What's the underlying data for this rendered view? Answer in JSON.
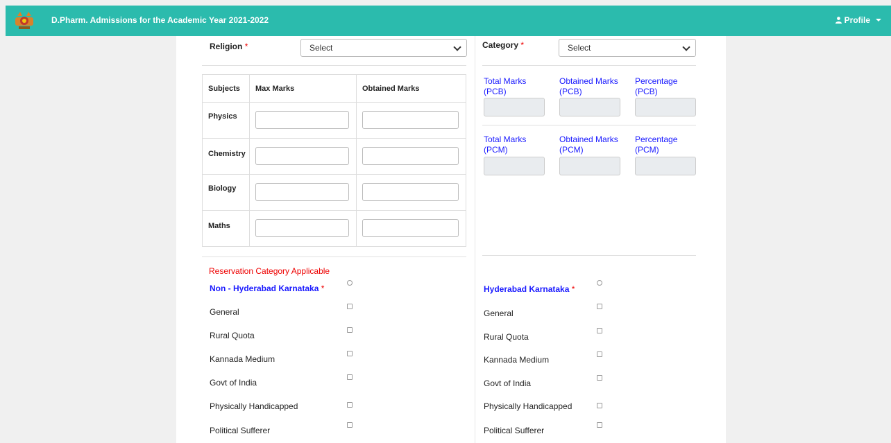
{
  "header": {
    "title": "D.Pharm. Admissions for the Academic Year 2021-2022",
    "profile_label": "Profile",
    "colors": {
      "bar": "#2bbbad"
    }
  },
  "form": {
    "religion": {
      "label": "Religion",
      "required_mark": "*",
      "value": "Select"
    },
    "category": {
      "label": "Category",
      "required_mark": "*",
      "value": "Select"
    },
    "marks_table": {
      "headers": [
        "Subjects",
        "Max Marks",
        "Obtained Marks"
      ],
      "rows": [
        {
          "subject": "Physics",
          "max": "",
          "obtained": ""
        },
        {
          "subject": "Chemistry",
          "max": "",
          "obtained": ""
        },
        {
          "subject": "Biology",
          "max": "",
          "obtained": ""
        },
        {
          "subject": "Maths",
          "max": "",
          "obtained": ""
        }
      ]
    },
    "pcb": {
      "total": {
        "line1": "Total Marks",
        "line2": "(PCB)"
      },
      "obtained": {
        "line1": "Obtained Marks",
        "line2": "(PCB)"
      },
      "percentage": {
        "line1": "Percentage",
        "line2": "(PCB)"
      }
    },
    "pcm": {
      "total": {
        "line1": "Total Marks",
        "line2": "(PCM)"
      },
      "obtained": {
        "line1": "Obtained Marks",
        "line2": "(PCM)"
      },
      "percentage": {
        "line1": "Percentage",
        "line2": "(PCM)"
      }
    },
    "reservation": {
      "heading": "Reservation Category Applicable",
      "left": {
        "title": "Non - Hyderabad Karnataka",
        "required_mark": "*",
        "items": [
          "General",
          "Rural Quota",
          "Kannada Medium",
          "Govt of India",
          "Physically Handicapped",
          "Political Sufferer"
        ]
      },
      "right": {
        "title": "Hyderabad Karnataka",
        "required_mark": "*",
        "items": [
          "General",
          "Rural Quota",
          "Kannada Medium",
          "Govt of India",
          "Physically Handicapped",
          "Political Sufferer"
        ]
      }
    }
  }
}
